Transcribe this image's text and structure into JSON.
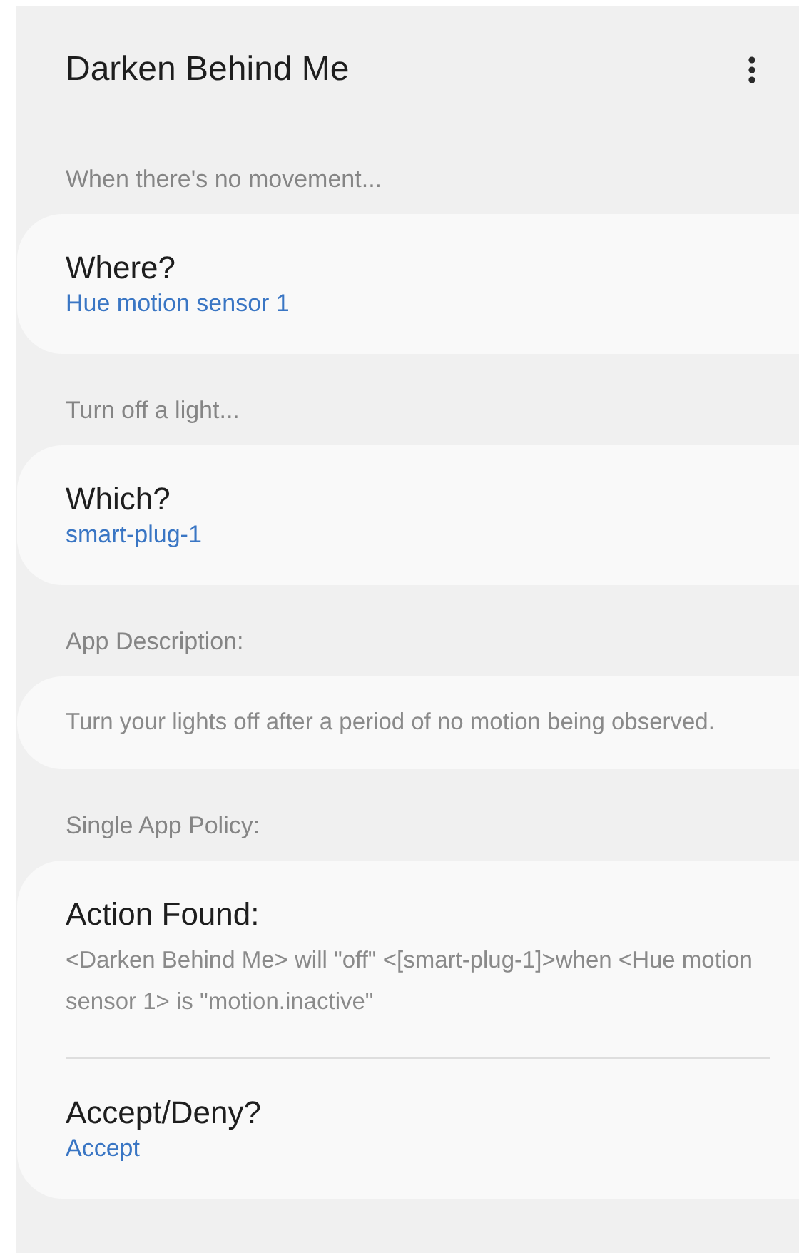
{
  "header": {
    "title": "Darken Behind Me"
  },
  "sections": [
    {
      "heading": "When there's no movement...",
      "items": [
        {
          "kind": "setting",
          "label": "Where?",
          "value": "Hue motion sensor 1"
        }
      ]
    },
    {
      "heading": "Turn off a light...",
      "items": [
        {
          "kind": "setting",
          "label": "Which?",
          "value": "smart-plug-1"
        }
      ]
    },
    {
      "heading": "App Description:",
      "items": [
        {
          "kind": "text",
          "text": "Turn your lights off after a period of no motion being observed."
        }
      ]
    },
    {
      "heading": "Single App Policy:",
      "items": [
        {
          "kind": "info",
          "label": "Action Found:",
          "text": "<Darken Behind Me> will \"off\" <[smart-plug-1]>when <Hue motion sensor 1> is \"motion.inactive\""
        },
        {
          "kind": "setting",
          "label": "Accept/Deny?",
          "value": "Accept"
        }
      ]
    }
  ]
}
